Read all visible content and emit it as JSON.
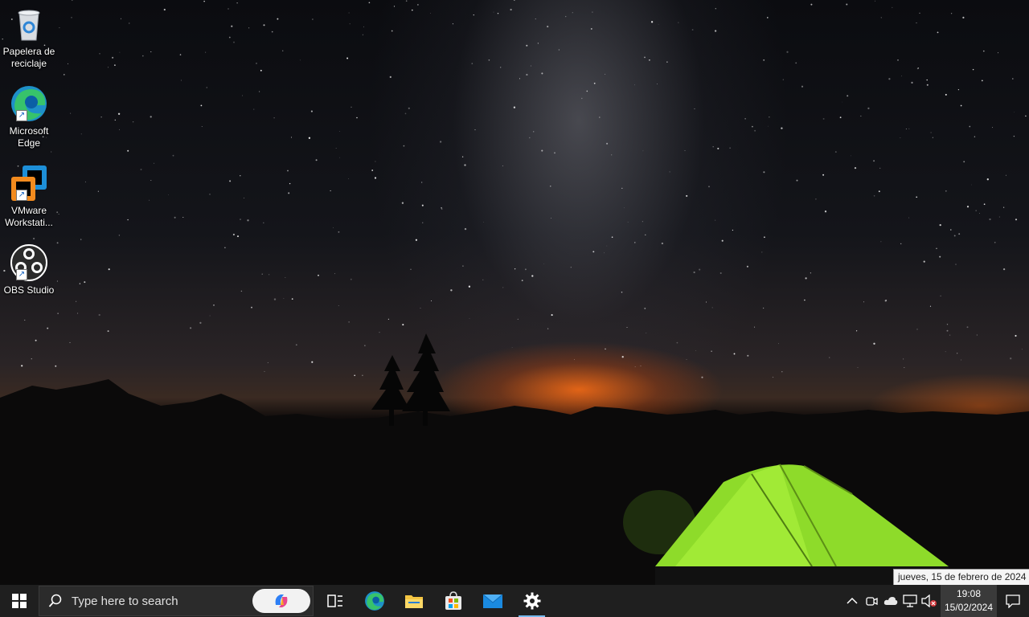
{
  "desktop": {
    "icons": [
      {
        "label": "Papelera de reciclaje",
        "icon": "recycle-bin-icon"
      },
      {
        "label": "Microsoft Edge",
        "icon": "edge-icon"
      },
      {
        "label": "VMware Workstati...",
        "icon": "vmware-icon"
      },
      {
        "label": "OBS Studio",
        "icon": "obs-icon"
      }
    ]
  },
  "taskbar": {
    "search_placeholder": "Type here to search",
    "apps": [
      {
        "name": "Task View",
        "icon": "task-view-icon"
      },
      {
        "name": "Microsoft Edge",
        "icon": "edge-icon"
      },
      {
        "name": "File Explorer",
        "icon": "folder-icon"
      },
      {
        "name": "Microsoft Store",
        "icon": "store-icon"
      },
      {
        "name": "Mail",
        "icon": "mail-icon"
      },
      {
        "name": "Settings",
        "icon": "gear-icon",
        "active": true
      }
    ],
    "tray": {
      "icons": [
        "chevron-up-icon",
        "meet-now-icon",
        "onedrive-cloud-icon",
        "network-icon",
        "volume-muted-icon"
      ],
      "time": "19:08",
      "date": "15/02/2024",
      "tooltip": "jueves, 15 de febrero de 2024"
    }
  },
  "colors": {
    "taskbar_bg": "#1f1f1f",
    "active_indicator": "#76b9ed",
    "tent_green": "#8edb2a"
  }
}
